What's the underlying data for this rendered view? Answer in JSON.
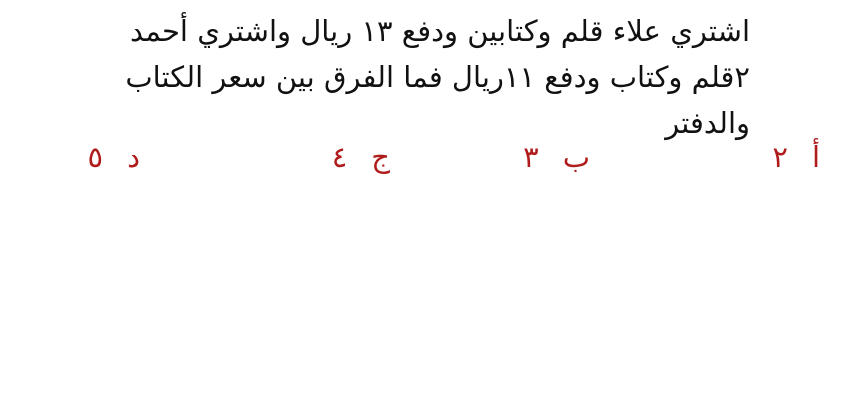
{
  "question": {
    "lines": [
      "اشتري علاء قلم وكتابين ودفع ١٣ ريال واشتري أحمد",
      "٢قلم وكتاب ودفع ١١ريال فما الفرق بين سعر الكتاب",
      "والدفتر"
    ]
  },
  "options": [
    {
      "letter": "أ",
      "value": "٢"
    },
    {
      "letter": "ب",
      "value": "٣"
    },
    {
      "letter": "ج",
      "value": "٤"
    },
    {
      "letter": "د",
      "value": "٥"
    }
  ],
  "colors": {
    "text": "#111111",
    "options": "#b01c1c"
  }
}
